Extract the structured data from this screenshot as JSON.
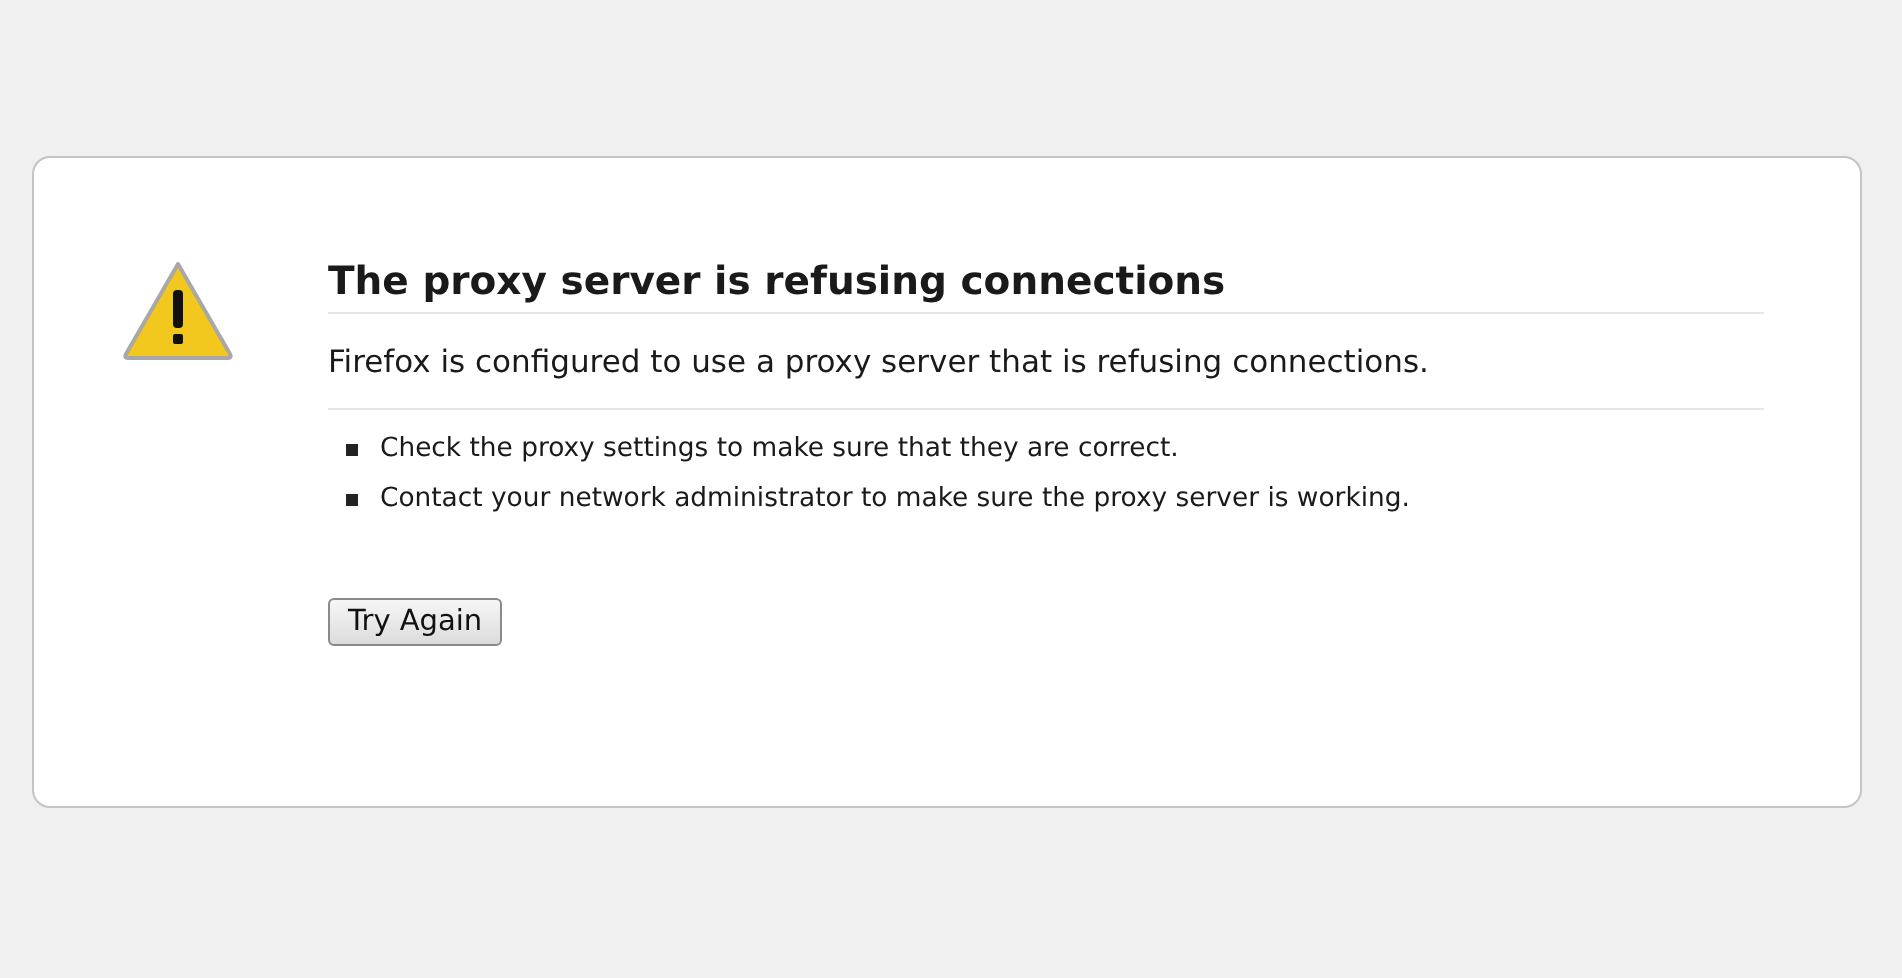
{
  "error": {
    "title": "The proxy server is refusing connections",
    "description": "Firefox is configured to use a proxy server that is refusing connections.",
    "suggestions": [
      "Check the proxy settings to make sure that they are correct.",
      "Contact your network administrator to make sure the proxy server is working."
    ],
    "button": "Try Again"
  }
}
